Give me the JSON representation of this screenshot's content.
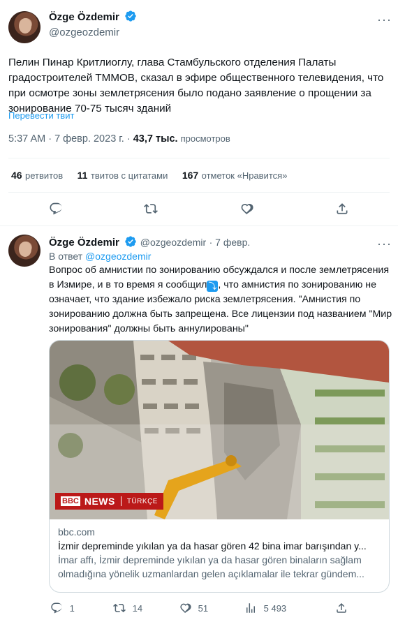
{
  "tweet": {
    "author_name": "Özge Özdemir",
    "author_handle": "@ozgeozdemir",
    "text": "Пелин Пинар Критлиоглу, глава Стамбульского отделения Палаты градостроителей ТММОВ, сказал в эфире общественного телевидения, что при осмотре зоны землетрясения было подано заявление о прощении за зонирование 70-75 тысяч зданий",
    "translate_label": "Перевести твит",
    "timestamp": "5:37 AM · 7 февр. 2023 г. ·",
    "views_count": "43,7 тыс.",
    "views_label": "просмотров",
    "stats": {
      "retweets_count": "46",
      "retweets_label": "ретвитов",
      "quotes_count": "11",
      "quotes_label": "твитов с цитатами",
      "likes_count": "167",
      "likes_label": "отметок «Нравится»"
    }
  },
  "reply": {
    "author_name": "Özge Özdemir",
    "author_handle": "@ozgeozdemir",
    "date": "· 7 февр.",
    "reply_to_prefix": "В ответ",
    "reply_to_handle": "@ozgeozdemir",
    "text_part1": "Вопрос об амнистии по зонированию обсуждался и после землетрясения в Измире, и в то время я сообщил",
    "text_part2": ", что амнистия по зонированию не означает, что здание избежало риска землетрясения. \"Амнистия по зонированию должна быть запрещена. Все лицензии под названием \"Мир зонирования\" должны быть аннулированы\"",
    "card": {
      "image_logo_bbc": "BBC",
      "image_logo_news": "NEWS",
      "image_logo_lang": "TÜRKÇE",
      "domain": "bbc.com",
      "title": "İzmir depreminde yıkılan ya da hasar gören 42 bina imar barışından y...",
      "description": "İmar affı, İzmir depreminde yıkılan ya da hasar gören binaların sağlam olmadığına yönelik uzmanlardan gelen açıklamalar ile tekrar gündem..."
    },
    "actions": {
      "replies": "1",
      "retweets": "14",
      "likes": "51",
      "views": "5 493"
    }
  },
  "colors": {
    "accent": "#1d9bf0",
    "muted": "#536471",
    "bbc_red": "#bb1919"
  }
}
